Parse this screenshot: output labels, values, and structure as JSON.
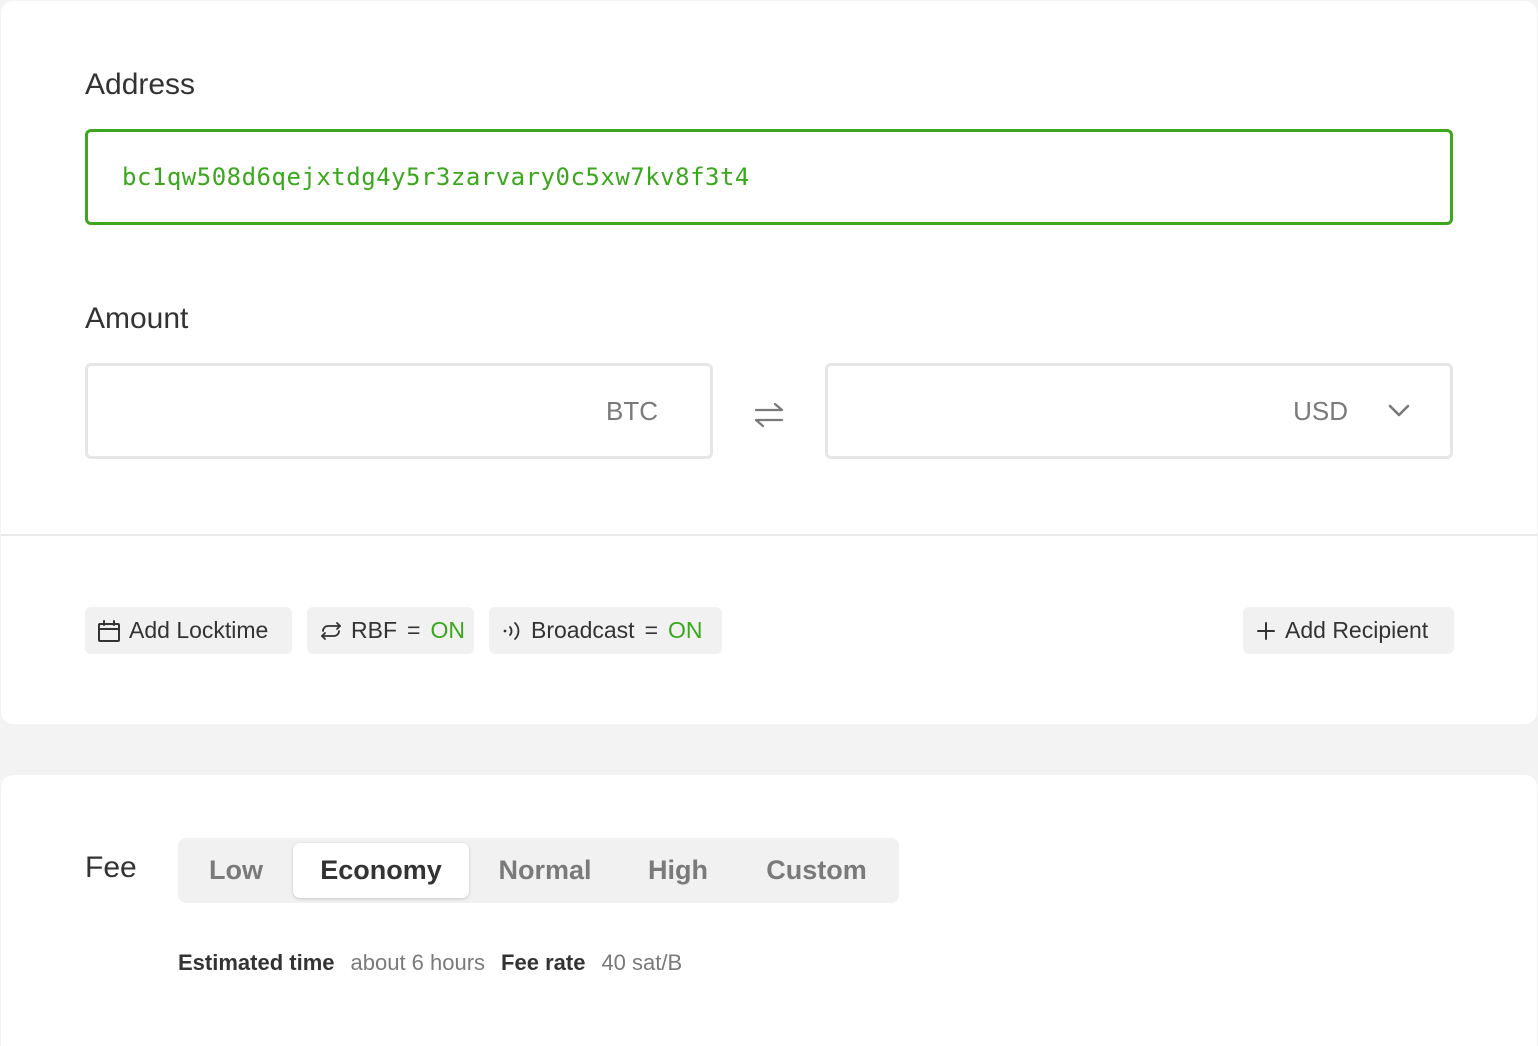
{
  "recipient": {
    "address_label": "Address",
    "address_value": "bc1qw508d6qejxtdg4y5r3zarvary0c5xw7kv8f3t4",
    "amount_label": "Amount",
    "btc_unit": "BTC",
    "fiat_unit": "USD"
  },
  "options": {
    "locktime_label": "Add Locktime",
    "rbf_label": "RBF",
    "rbf_equals": "=",
    "rbf_value": "ON",
    "broadcast_label": "Broadcast",
    "broadcast_equals": "=",
    "broadcast_value": "ON",
    "add_recipient_label": "Add Recipient"
  },
  "fee": {
    "label": "Fee",
    "options": [
      "Low",
      "Economy",
      "Normal",
      "High",
      "Custom"
    ],
    "selected": "Economy",
    "estimated_time_label": "Estimated time",
    "estimated_time_value": "about 6 hours",
    "fee_rate_label": "Fee rate",
    "fee_rate_value": "40 sat/B"
  },
  "icons": {
    "locktime": "calendar-icon",
    "rbf": "replace-arrows-icon",
    "broadcast": "broadcast-icon",
    "add": "plus-icon",
    "swap": "swap-arrows-icon",
    "dropdown": "chevron-down-icon"
  },
  "colors": {
    "accent_green": "#3ba71d",
    "muted_text": "#7a7a7a",
    "chip_bg": "#f1f1f1"
  }
}
